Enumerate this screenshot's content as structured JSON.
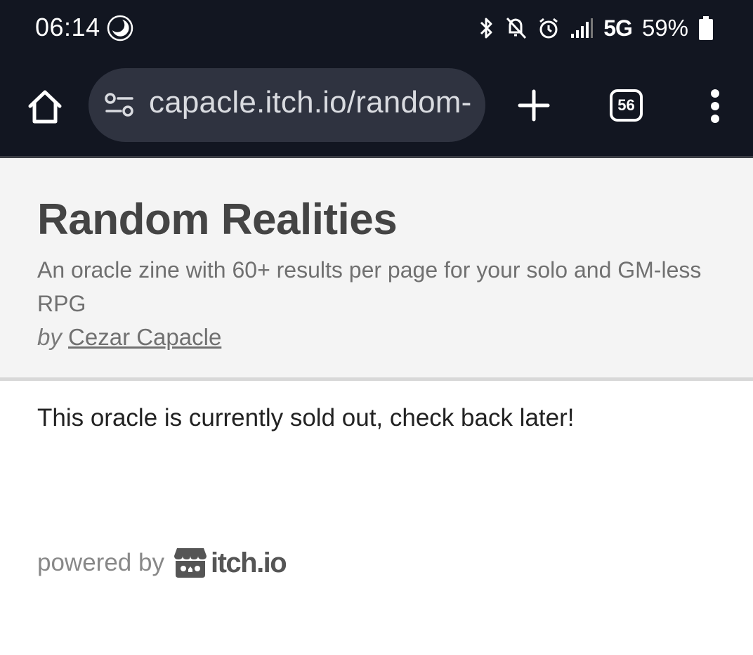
{
  "status_bar": {
    "time": "06:14",
    "network": "5G",
    "battery": "59%",
    "icons": [
      "moon-icon",
      "bluetooth-icon",
      "mute-icon",
      "alarm-icon",
      "signal-icon",
      "battery-icon"
    ]
  },
  "browser": {
    "url": "capacle.itch.io/random-realities",
    "tab_count": "56",
    "icons": [
      "home-icon",
      "site-settings-icon",
      "plus-icon",
      "more-vert-icon"
    ]
  },
  "page": {
    "title": "Random Realities",
    "tagline": "An oracle zine with 60+ results per page for your solo and GM-less RPG",
    "byline_prefix": "by",
    "author": "Cezar Capacle",
    "message": "This oracle is currently sold out, check back later!",
    "footer": {
      "powered_by": "powered by",
      "brand": "itch.io"
    }
  },
  "colors": {
    "chrome_bg": "#121621",
    "url_bar_bg": "#2f3340",
    "header_bg": "#f4f4f4",
    "title_text": "#444444"
  }
}
